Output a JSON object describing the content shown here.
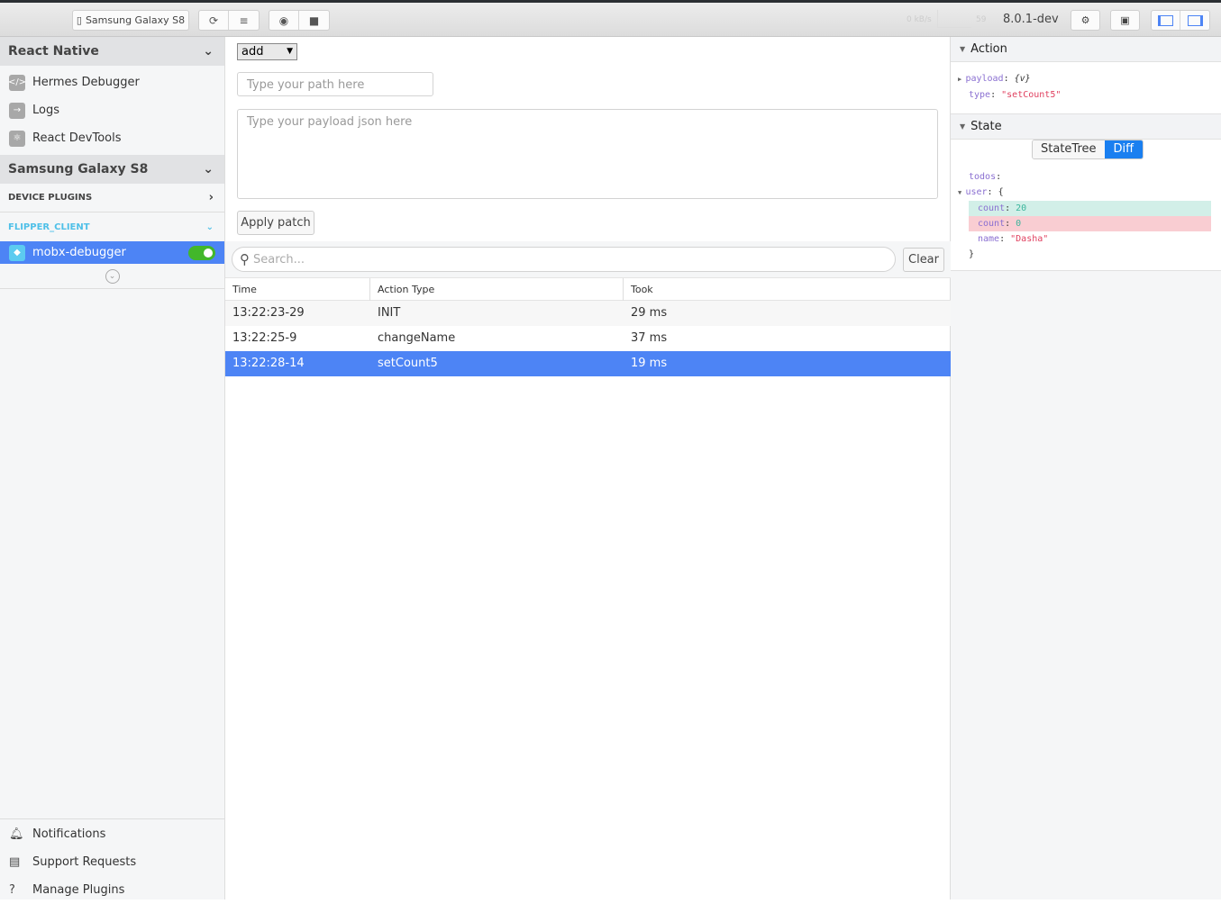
{
  "toolbar": {
    "device": "Samsung Galaxy S8",
    "bandwidth": "0 kB/s",
    "fps": "59",
    "version": "8.0.1-dev"
  },
  "sidebar": {
    "react_native": {
      "title": "React Native",
      "items": [
        {
          "label": "Hermes Debugger",
          "icon": "code-icon"
        },
        {
          "label": "Logs",
          "icon": "arrow-right-icon"
        },
        {
          "label": "React DevTools",
          "icon": "react-icon"
        }
      ]
    },
    "device": {
      "title": "Samsung Galaxy S8",
      "device_plugins": "DEVICE PLUGINS",
      "client": "FLIPPER_CLIENT",
      "plugin": "mobx-debugger",
      "plugin_enabled": true
    },
    "footer": [
      {
        "label": "Notifications",
        "icon": "bell-icon"
      },
      {
        "label": "Support Requests",
        "icon": "support-icon"
      },
      {
        "label": "Manage Plugins",
        "icon": "question-icon"
      }
    ]
  },
  "main": {
    "op_select": "add",
    "path_placeholder": "Type your path here",
    "payload_placeholder": "Type your payload json here",
    "apply": "Apply patch",
    "search_placeholder": "Search...",
    "clear": "Clear",
    "columns": [
      "Time",
      "Action Type",
      "Took"
    ],
    "rows": [
      [
        "13:22:23-29",
        "INIT",
        "29 ms"
      ],
      [
        "13:22:25-9",
        "changeName",
        "37 ms"
      ],
      [
        "13:22:28-14",
        "setCount5",
        "19 ms"
      ]
    ],
    "selected_row": 2
  },
  "right": {
    "action_title": "Action",
    "payload_key": "payload",
    "payload_val": "{v}",
    "type_key": "type",
    "type_val": "\"setCount5\"",
    "state_title": "State",
    "tab_tree": "StateTree",
    "tab_diff": "Diff",
    "todos": "todos",
    "user": "user",
    "open": "{",
    "count": "count",
    "count_new": "20",
    "count_old": "0",
    "name": "name",
    "name_val": "\"Dasha\"",
    "close": "}"
  },
  "colors": {
    "accent": "#4d84f5",
    "added": "#d2efe8",
    "removed": "#f9cdd2",
    "toggle": "#42b72a"
  }
}
